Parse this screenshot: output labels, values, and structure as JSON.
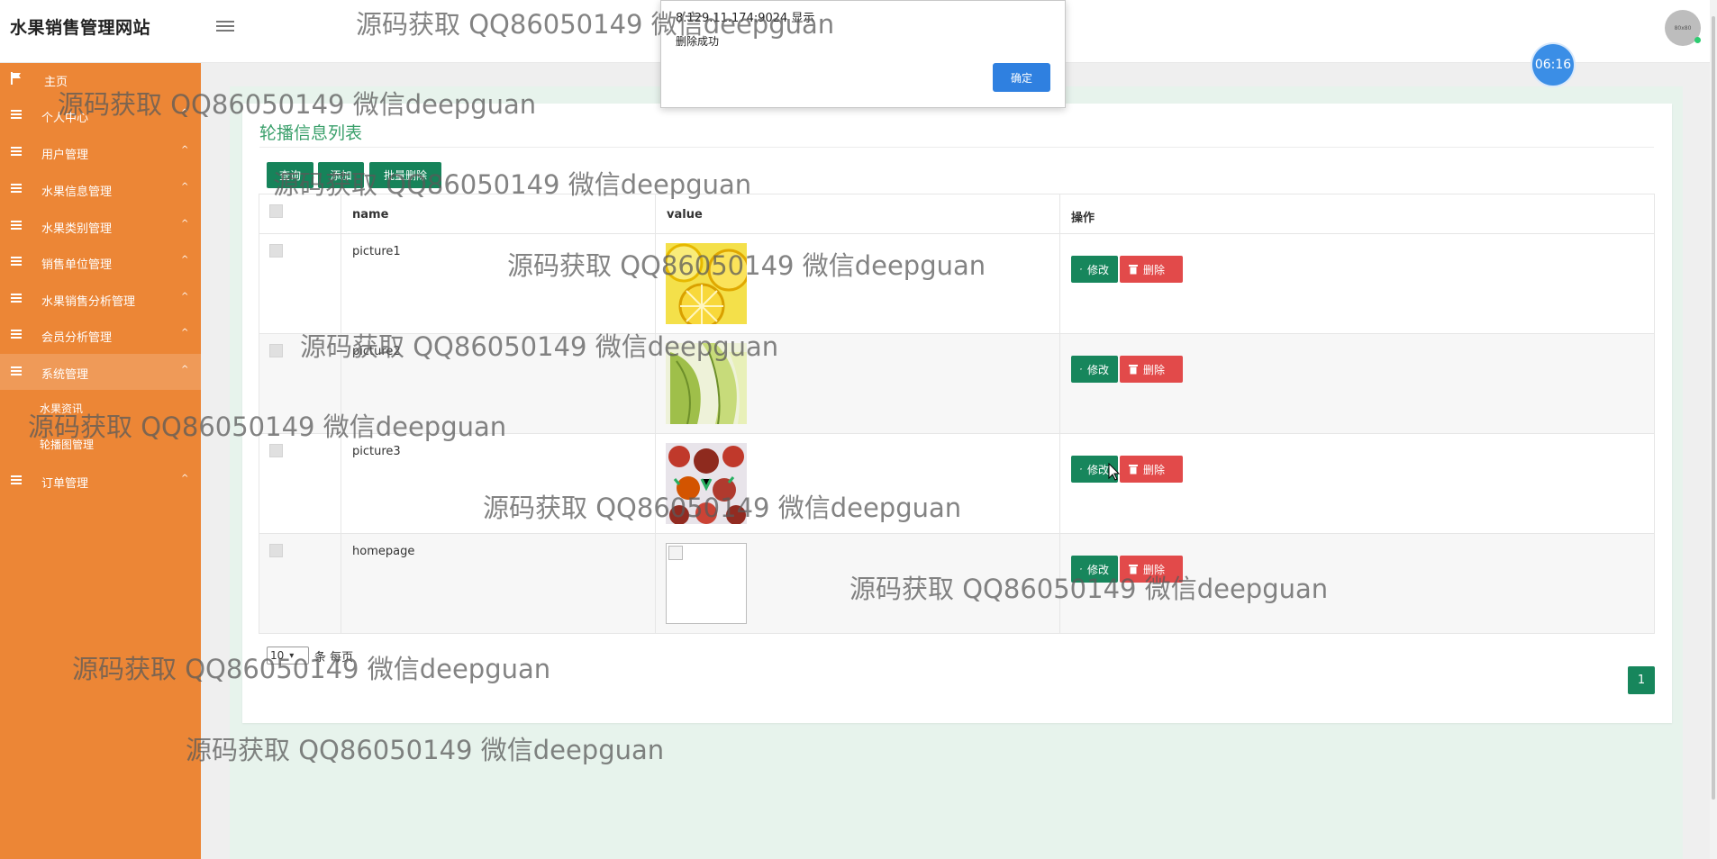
{
  "site_title": "水果销售管理网站",
  "avatar_text": "80x80",
  "colors": {
    "sidebar": "#ec8636",
    "primary_green": "#16835a",
    "danger_red": "#e24a4a",
    "title_green": "#3aa06b"
  },
  "sidebar": {
    "items": [
      {
        "label": "主页",
        "icon": "flag-icon"
      },
      {
        "label": "个人中心",
        "icon": "menu-icon"
      },
      {
        "label": "用户管理",
        "icon": "menu-icon"
      },
      {
        "label": "水果信息管理",
        "icon": "menu-icon"
      },
      {
        "label": "水果类别管理",
        "icon": "menu-icon"
      },
      {
        "label": "销售单位管理",
        "icon": "menu-icon"
      },
      {
        "label": "水果销售分析管理",
        "icon": "menu-icon"
      },
      {
        "label": "会员分析管理",
        "icon": "menu-icon"
      },
      {
        "label": "系统管理",
        "icon": "menu-icon"
      },
      {
        "label": "订单管理",
        "icon": "menu-icon"
      }
    ],
    "sub_items": [
      "水果资讯",
      "轮播图管理"
    ],
    "caret": "^"
  },
  "panel": {
    "title": "轮播信息列表",
    "toolbar": {
      "query": "查询",
      "add": "添加",
      "batch_delete": "批量删除"
    },
    "columns": {
      "name": "name",
      "value": "value",
      "actions": "操作"
    },
    "rows": [
      {
        "name": "picture1",
        "image": "lemon"
      },
      {
        "name": "picture2",
        "image": "melon"
      },
      {
        "name": "picture3",
        "image": "strawberry"
      },
      {
        "name": "homepage",
        "image": "broken"
      }
    ],
    "edit_label": "修改",
    "delete_label": "删除",
    "page_size": "10",
    "page_size_suffix": "条 每页",
    "current_page": "1"
  },
  "clock": "06:16",
  "alert": {
    "title": "8.129.11.174:9024 显示",
    "message": "删除成功",
    "ok": "确定"
  },
  "watermark": "源码获取 QQ86050149 微信deepguan"
}
